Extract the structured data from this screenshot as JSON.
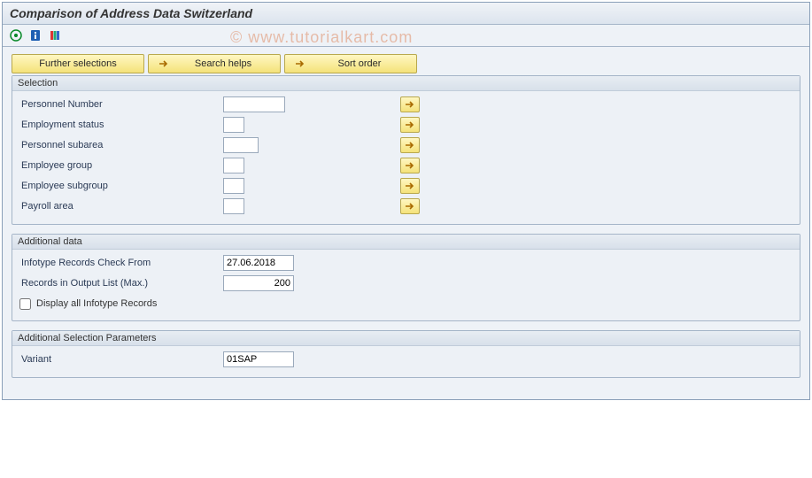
{
  "header": {
    "title": "Comparison of Address Data Switzerland"
  },
  "watermark": "© www.tutorialkart.com",
  "topButtons": {
    "further": "Further selections",
    "search": "Search helps",
    "sort": "Sort order"
  },
  "groups": {
    "selection": {
      "title": "Selection",
      "rows": {
        "pernr": {
          "label": "Personnel Number",
          "value": ""
        },
        "status": {
          "label": "Employment status",
          "value": ""
        },
        "subarea": {
          "label": "Personnel subarea",
          "value": ""
        },
        "egroup": {
          "label": "Employee group",
          "value": ""
        },
        "esubgroup": {
          "label": "Employee subgroup",
          "value": ""
        },
        "payroll": {
          "label": "Payroll area",
          "value": ""
        }
      }
    },
    "additional": {
      "title": "Additional data",
      "rows": {
        "checkfrom": {
          "label": "Infotype Records Check From",
          "value": "27.06.2018"
        },
        "maxrec": {
          "label": "Records in Output List (Max.)",
          "value": "200"
        },
        "displayall": {
          "label": "Display all Infotype Records",
          "checked": false
        }
      }
    },
    "params": {
      "title": "Additional Selection Parameters",
      "rows": {
        "variant": {
          "label": "Variant",
          "value": "01SAP"
        }
      }
    }
  }
}
